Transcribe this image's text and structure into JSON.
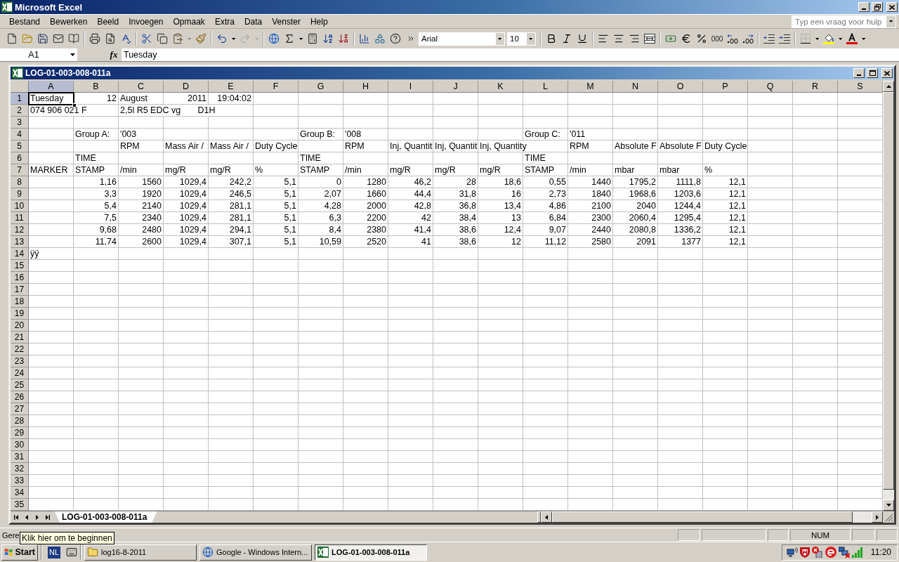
{
  "window": {
    "title": "Microsoft Excel"
  },
  "menu": [
    "Bestand",
    "Bewerken",
    "Beeld",
    "Invoegen",
    "Opmaak",
    "Extra",
    "Data",
    "Venster",
    "Help"
  ],
  "help_search": {
    "placeholder": "Typ een vraag voor hulp"
  },
  "toolbar": {
    "redo_disabled": true,
    "font_name": "Arial",
    "font_size": "10",
    "thousands_button": "000"
  },
  "formula_bar": {
    "cell": "A1",
    "function_button": "fx",
    "value": "Tuesday"
  },
  "workbook": {
    "title": "LOG-01-003-008-011a"
  },
  "sheet": {
    "columns": [
      {
        "label": "A",
        "selected": true
      },
      {
        "label": "B",
        "selected": false
      },
      {
        "label": "C",
        "selected": false
      },
      {
        "label": "D",
        "selected": false
      },
      {
        "label": "E",
        "selected": false
      },
      {
        "label": "F",
        "selected": false
      },
      {
        "label": "G",
        "selected": false
      },
      {
        "label": "H",
        "selected": false
      },
      {
        "label": "I",
        "selected": false
      },
      {
        "label": "J",
        "selected": false
      },
      {
        "label": "K",
        "selected": false
      },
      {
        "label": "L",
        "selected": false
      },
      {
        "label": "M",
        "selected": false
      },
      {
        "label": "N",
        "selected": false
      },
      {
        "label": "O",
        "selected": false
      },
      {
        "label": "P",
        "selected": false
      },
      {
        "label": "Q",
        "selected": false
      },
      {
        "label": "R",
        "selected": false
      },
      {
        "label": "S",
        "selected": false
      }
    ],
    "rows": [
      {
        "label": "1",
        "selected": true,
        "cells": [
          {
            "value": "Tuesday",
            "kind": "text"
          },
          {
            "value": "12",
            "kind": "number"
          },
          {
            "value": "August",
            "kind": "text"
          },
          {
            "value": "2011",
            "kind": "number"
          },
          {
            "value": "19:04:02",
            "kind": "number"
          }
        ]
      },
      {
        "label": "2",
        "selected": false,
        "cells": [
          {
            "value": "074 906 021 F",
            "kind": "text"
          },
          null,
          {
            "value": "2,5l R5 EDC vg       D1H",
            "kind": "text"
          }
        ]
      },
      {
        "label": "3",
        "selected": false
      },
      {
        "label": "4",
        "selected": false,
        "cells": [
          null,
          {
            "value": "Group A:",
            "kind": "text"
          },
          {
            "value": "'003",
            "kind": "text"
          },
          null,
          null,
          null,
          {
            "value": "Group B:",
            "kind": "text"
          },
          {
            "value": "'008",
            "kind": "text"
          },
          null,
          null,
          null,
          {
            "value": "Group C:",
            "kind": "text"
          },
          {
            "value": "'011",
            "kind": "text"
          }
        ]
      },
      {
        "label": "5",
        "selected": false,
        "cells": [
          null,
          null,
          {
            "value": "RPM",
            "kind": "text"
          },
          {
            "value": "Mass Air /",
            "kind": "text"
          },
          {
            "value": "Mass Air /",
            "kind": "text"
          },
          {
            "value": "Duty Cycle",
            "kind": "text"
          },
          null,
          {
            "value": "RPM",
            "kind": "text"
          },
          {
            "value": "Inj, Quantit",
            "kind": "text"
          },
          {
            "value": "Inj, Quantit",
            "kind": "text"
          },
          {
            "value": "Inj, Quantity",
            "kind": "text"
          },
          null,
          {
            "value": "RPM",
            "kind": "text"
          },
          {
            "value": "Absolute F",
            "kind": "text"
          },
          {
            "value": "Absolute F",
            "kind": "text"
          },
          {
            "value": "Duty Cycle",
            "kind": "text"
          }
        ]
      },
      {
        "label": "6",
        "selected": false,
        "cells": [
          null,
          {
            "value": "TIME",
            "kind": "text"
          },
          null,
          null,
          null,
          null,
          {
            "value": "TIME",
            "kind": "text"
          },
          null,
          null,
          null,
          null,
          {
            "value": "TIME",
            "kind": "text"
          }
        ]
      },
      {
        "label": "7",
        "selected": false,
        "cells": [
          {
            "value": "MARKER",
            "kind": "text"
          },
          {
            "value": "STAMP",
            "kind": "text"
          },
          {
            "value": "/min",
            "kind": "text"
          },
          {
            "value": "mg/R",
            "kind": "text"
          },
          {
            "value": "mg/R",
            "kind": "text"
          },
          {
            "value": "%",
            "kind": "text"
          },
          {
            "value": "STAMP",
            "kind": "text"
          },
          {
            "value": "/min",
            "kind": "text"
          },
          {
            "value": "mg/R",
            "kind": "text"
          },
          {
            "value": "mg/R",
            "kind": "text"
          },
          {
            "value": "mg/R",
            "kind": "text"
          },
          {
            "value": "STAMP",
            "kind": "text"
          },
          {
            "value": "/min",
            "kind": "text"
          },
          {
            "value": "mbar",
            "kind": "text"
          },
          {
            "value": "mbar",
            "kind": "text"
          },
          {
            "value": "%",
            "kind": "text"
          }
        ]
      },
      {
        "label": "8",
        "selected": false,
        "cells": [
          null,
          {
            "value": "1,16",
            "kind": "number"
          },
          {
            "value": "1560",
            "kind": "number"
          },
          {
            "value": "1029,4",
            "kind": "number"
          },
          {
            "value": "242,2",
            "kind": "number"
          },
          {
            "value": "5,1",
            "kind": "number"
          },
          {
            "value": "0",
            "kind": "number"
          },
          {
            "value": "1280",
            "kind": "number"
          },
          {
            "value": "46,2",
            "kind": "number"
          },
          {
            "value": "28",
            "kind": "number"
          },
          {
            "value": "18,6",
            "kind": "number"
          },
          {
            "value": "0,55",
            "kind": "number"
          },
          {
            "value": "1440",
            "kind": "number"
          },
          {
            "value": "1795,2",
            "kind": "number"
          },
          {
            "value": "1111,8",
            "kind": "number"
          },
          {
            "value": "12,1",
            "kind": "number"
          }
        ]
      },
      {
        "label": "9",
        "selected": false,
        "cells": [
          null,
          {
            "value": "3,3",
            "kind": "number"
          },
          {
            "value": "1920",
            "kind": "number"
          },
          {
            "value": "1029,4",
            "kind": "number"
          },
          {
            "value": "246,5",
            "kind": "number"
          },
          {
            "value": "5,1",
            "kind": "number"
          },
          {
            "value": "2,07",
            "kind": "number"
          },
          {
            "value": "1660",
            "kind": "number"
          },
          {
            "value": "44,4",
            "kind": "number"
          },
          {
            "value": "31,8",
            "kind": "number"
          },
          {
            "value": "16",
            "kind": "number"
          },
          {
            "value": "2,73",
            "kind": "number"
          },
          {
            "value": "1840",
            "kind": "number"
          },
          {
            "value": "1968,6",
            "kind": "number"
          },
          {
            "value": "1203,6",
            "kind": "number"
          },
          {
            "value": "12,1",
            "kind": "number"
          }
        ]
      },
      {
        "label": "10",
        "selected": false,
        "cells": [
          null,
          {
            "value": "5,4",
            "kind": "number"
          },
          {
            "value": "2140",
            "kind": "number"
          },
          {
            "value": "1029,4",
            "kind": "number"
          },
          {
            "value": "281,1",
            "kind": "number"
          },
          {
            "value": "5,1",
            "kind": "number"
          },
          {
            "value": "4,28",
            "kind": "number"
          },
          {
            "value": "2000",
            "kind": "number"
          },
          {
            "value": "42,8",
            "kind": "number"
          },
          {
            "value": "36,8",
            "kind": "number"
          },
          {
            "value": "13,4",
            "kind": "number"
          },
          {
            "value": "4,86",
            "kind": "number"
          },
          {
            "value": "2100",
            "kind": "number"
          },
          {
            "value": "2040",
            "kind": "number"
          },
          {
            "value": "1244,4",
            "kind": "number"
          },
          {
            "value": "12,1",
            "kind": "number"
          }
        ]
      },
      {
        "label": "11",
        "selected": false,
        "cells": [
          null,
          {
            "value": "7,5",
            "kind": "number"
          },
          {
            "value": "2340",
            "kind": "number"
          },
          {
            "value": "1029,4",
            "kind": "number"
          },
          {
            "value": "281,1",
            "kind": "number"
          },
          {
            "value": "5,1",
            "kind": "number"
          },
          {
            "value": "6,3",
            "kind": "number"
          },
          {
            "value": "2200",
            "kind": "number"
          },
          {
            "value": "42",
            "kind": "number"
          },
          {
            "value": "38,4",
            "kind": "number"
          },
          {
            "value": "13",
            "kind": "number"
          },
          {
            "value": "6,84",
            "kind": "number"
          },
          {
            "value": "2300",
            "kind": "number"
          },
          {
            "value": "2060,4",
            "kind": "number"
          },
          {
            "value": "1295,4",
            "kind": "number"
          },
          {
            "value": "12,1",
            "kind": "number"
          }
        ]
      },
      {
        "label": "12",
        "selected": false,
        "cells": [
          null,
          {
            "value": "9,68",
            "kind": "number"
          },
          {
            "value": "2480",
            "kind": "number"
          },
          {
            "value": "1029,4",
            "kind": "number"
          },
          {
            "value": "294,1",
            "kind": "number"
          },
          {
            "value": "5,1",
            "kind": "number"
          },
          {
            "value": "8,4",
            "kind": "number"
          },
          {
            "value": "2380",
            "kind": "number"
          },
          {
            "value": "41,4",
            "kind": "number"
          },
          {
            "value": "38,6",
            "kind": "number"
          },
          {
            "value": "12,4",
            "kind": "number"
          },
          {
            "value": "9,07",
            "kind": "number"
          },
          {
            "value": "2440",
            "kind": "number"
          },
          {
            "value": "2080,8",
            "kind": "number"
          },
          {
            "value": "1336,2",
            "kind": "number"
          },
          {
            "value": "12,1",
            "kind": "number"
          }
        ]
      },
      {
        "label": "13",
        "selected": false,
        "cells": [
          null,
          {
            "value": "11,74",
            "kind": "number"
          },
          {
            "value": "2600",
            "kind": "number"
          },
          {
            "value": "1029,4",
            "kind": "number"
          },
          {
            "value": "307,1",
            "kind": "number"
          },
          {
            "value": "5,1",
            "kind": "number"
          },
          {
            "value": "10,59",
            "kind": "number"
          },
          {
            "value": "2520",
            "kind": "number"
          },
          {
            "value": "41",
            "kind": "number"
          },
          {
            "value": "38,6",
            "kind": "number"
          },
          {
            "value": "12",
            "kind": "number"
          },
          {
            "value": "11,12",
            "kind": "number"
          },
          {
            "value": "2580",
            "kind": "number"
          },
          {
            "value": "2091",
            "kind": "number"
          },
          {
            "value": "1377",
            "kind": "number"
          },
          {
            "value": "12,1",
            "kind": "number"
          }
        ]
      },
      {
        "label": "14",
        "selected": false,
        "cells": [
          {
            "value": "ÿÿ",
            "kind": "text"
          }
        ]
      },
      {
        "label": "15",
        "selected": false
      },
      {
        "label": "16",
        "selected": false
      },
      {
        "label": "17",
        "selected": false
      },
      {
        "label": "18",
        "selected": false
      },
      {
        "label": "19",
        "selected": false
      },
      {
        "label": "20",
        "selected": false
      },
      {
        "label": "21",
        "selected": false
      },
      {
        "label": "22",
        "selected": false
      },
      {
        "label": "23",
        "selected": false
      },
      {
        "label": "24",
        "selected": false
      },
      {
        "label": "25",
        "selected": false
      },
      {
        "label": "26",
        "selected": false
      },
      {
        "label": "27",
        "selected": false
      },
      {
        "label": "28",
        "selected": false
      },
      {
        "label": "29",
        "selected": false
      },
      {
        "label": "30",
        "selected": false
      },
      {
        "label": "31",
        "selected": false
      },
      {
        "label": "32",
        "selected": false
      },
      {
        "label": "33",
        "selected": false
      },
      {
        "label": "34",
        "selected": false
      },
      {
        "label": "35",
        "selected": false
      }
    ]
  },
  "sheet_tabs": [
    {
      "label": "LOG-01-003-008-011a",
      "selected": true
    }
  ],
  "status_bar": {
    "text": "Gere",
    "indicator": "NUM"
  },
  "tooltip": {
    "text": "Klik hier om te beginnen"
  },
  "taskbar": {
    "start": "Start",
    "language": "NL",
    "tasks": [
      {
        "label": "log16-8-2011",
        "kind": "folder",
        "selected": false
      },
      {
        "label": "Google - Windows Intern...",
        "kind": "browser",
        "selected": false
      },
      {
        "label": "LOG-01-003-008-011a",
        "kind": "spreadsheet",
        "selected": true
      }
    ],
    "clock": "11:20"
  }
}
